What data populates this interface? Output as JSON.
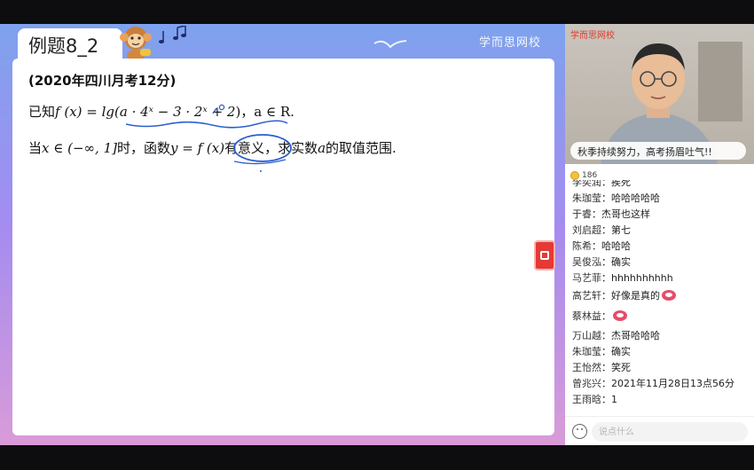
{
  "lesson": {
    "title": "例题8_2",
    "brand": "学而思网校",
    "problem": {
      "source": "(2020年四川月考12分)",
      "line1_prefix": "已知",
      "line1_fx": "f (x) = lg(",
      "line1_expr": "a · 4ˣ − 3 · 2ˣ + 2",
      "line1_suffix": ")，a ∈ R.",
      "line2_a": "当",
      "line2_cond": "x ∈ (−∞, 1]",
      "line2_b": "时，函数",
      "line2_fn": "y = f (x)",
      "line2_circled": "有意义",
      "line2_c": "，求实数",
      "line2_var": "a",
      "line2_d": "的取值范围."
    }
  },
  "video": {
    "brand": "学而思网校",
    "banner": "秋季持续努力，高考扬眉吐气!!"
  },
  "coins": {
    "count": "186"
  },
  "chat": {
    "messages": [
      {
        "name": "李奕润",
        "text": "挨死"
      },
      {
        "name": "朱珈莹",
        "text": "哈哈哈哈哈"
      },
      {
        "name": "于睿",
        "text": "杰哥也这样"
      },
      {
        "name": "刘启超",
        "text": "第七"
      },
      {
        "name": "陈希",
        "text": "哈哈哈"
      },
      {
        "name": "吴俊泓",
        "text": "确实"
      },
      {
        "name": "马艺菲",
        "text": "hhhhhhhhhh"
      },
      {
        "name": "高艺轩",
        "text": "好像是真的",
        "emoji": "laughing-face"
      },
      {
        "name": "蔡林益",
        "text": "",
        "emoji": "laughing-face"
      },
      {
        "name": "万山越",
        "text": "杰哥哈哈哈"
      },
      {
        "name": "朱珈莹",
        "text": "确实"
      },
      {
        "name": "王怡然",
        "text": "笑死"
      },
      {
        "name": "曾兆兴",
        "text": "2021年11月28日13点56分"
      },
      {
        "name": "王雨晗",
        "text": "1"
      }
    ],
    "input_placeholder": "说点什么"
  },
  "colors": {
    "ink_blue": "#2b5fd0",
    "flag_red": "#e53935",
    "brand_red": "#e23a2e"
  }
}
